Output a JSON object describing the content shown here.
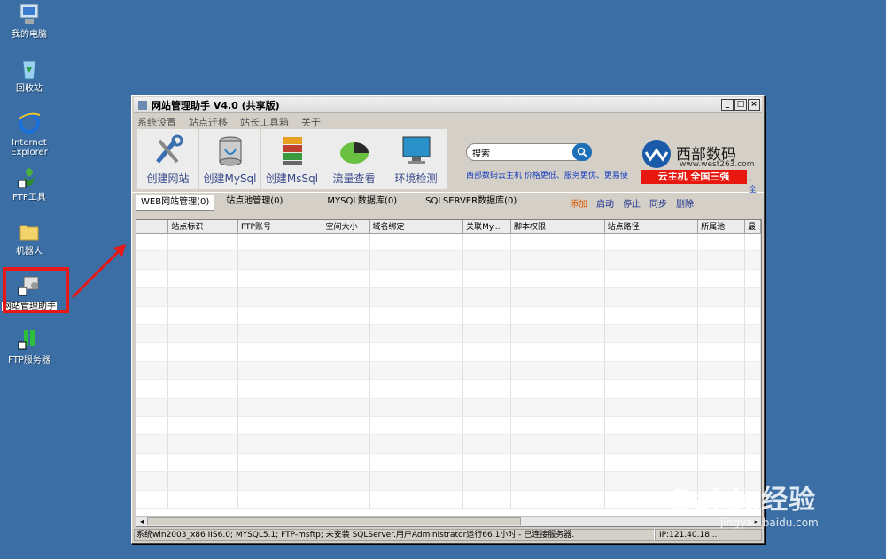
{
  "desktop": {
    "icons": [
      {
        "label": "我的电脑",
        "icon": "computer-icon"
      },
      {
        "label": "回收站",
        "icon": "recycle-bin-icon"
      },
      {
        "label": "Internet Explorer",
        "icon": "ie-icon"
      },
      {
        "label": "FTP工具",
        "icon": "ftp-tool-icon"
      },
      {
        "label": "机器人",
        "icon": "folder-icon"
      },
      {
        "label": "网站管理助手",
        "icon": "site-manager-shortcut-icon"
      },
      {
        "label": "FTP服务器",
        "icon": "ftp-server-icon"
      }
    ],
    "highlight_color": "#e81818"
  },
  "window": {
    "title": "网站管理助手 V4.0 (共享版)",
    "controls": {
      "minimize": "_",
      "maximize": "□",
      "close": "×"
    },
    "menu": [
      "系统设置",
      "站点迁移",
      "站长工具箱",
      "关于"
    ],
    "toolbar": [
      {
        "label": "创建网站",
        "icon": "tools-icon"
      },
      {
        "label": "创建MySql",
        "icon": "mysql-db-icon"
      },
      {
        "label": "创建MsSql",
        "icon": "mssql-db-icon"
      },
      {
        "label": "流量查看",
        "icon": "pie-chart-icon"
      },
      {
        "label": "环境检测",
        "icon": "monitor-icon"
      }
    ],
    "search": {
      "value": "搜索"
    },
    "promo_text": "西部数码云主机 价格更低、服务更优、更易使",
    "brand": {
      "name": "西部数码",
      "url": "www.west263.com",
      "banner": "云主机 全国三强",
      "banner_tail": "、全"
    },
    "tabs": [
      "WEB网站管理(0)",
      "站点池管理(0)",
      "MYSQL数据库(0)",
      "SQLSERVER数据库(0)"
    ],
    "actions": [
      "添加",
      "启动",
      "停止",
      "同步",
      "删除"
    ],
    "table": {
      "columns": [
        "",
        "站点标识",
        "FTP账号",
        "空间大小",
        "域名绑定",
        "关联My...",
        "脚本权限",
        "站点路径",
        "所属池",
        "最"
      ]
    },
    "status": {
      "main": "系统win2003_x86 IIS6.0; MYSQL5.1; FTP-msftp; 未安装 SQLServer.用户Administrator运行66.1小时 - 已连接服务器.",
      "ip": "IP:121.40.18..."
    }
  },
  "watermark": {
    "main": "Baidu经验",
    "sub": "jingyan.baidu.com"
  }
}
